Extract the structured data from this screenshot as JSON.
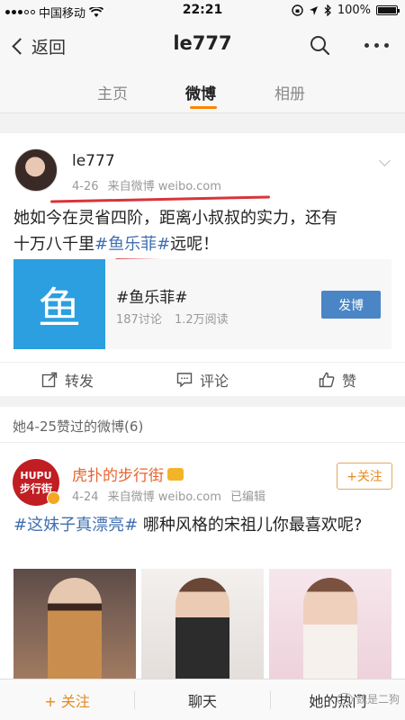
{
  "status_bar": {
    "carrier": "中国移动",
    "time": "22:21",
    "battery": "100%",
    "battery_level": 1.0
  },
  "nav": {
    "back_label": "返回",
    "title": "le777"
  },
  "tabs": [
    {
      "label": "主页",
      "active": false
    },
    {
      "label": "微博",
      "active": true
    },
    {
      "label": "相册",
      "active": false
    }
  ],
  "post": {
    "username": "le777",
    "date": "4-26",
    "source": "来自微博 weibo.com",
    "text_line1": "她如今在灵省四阶，距离小叔叔的实力，还有",
    "text_line2_pre": "十万八千里",
    "text_hashtag": "#鱼乐菲#",
    "text_line2_post": "远呢！",
    "topic": {
      "thumb_char": "鱼",
      "title": "#鱼乐菲#",
      "discussions": "187讨论",
      "reads": "1.2万阅读",
      "button_label": "发博"
    },
    "actions": {
      "repost": "转发",
      "comment": "评论",
      "like": "赞"
    }
  },
  "liked_section": {
    "header": "她4-25赞过的微博(6)"
  },
  "post2": {
    "logo_line1": "HUPU",
    "logo_line2": "步行街",
    "username": "虎扑的步行街",
    "date": "4-24",
    "source": "来自微博 weibo.com",
    "edited": "已编辑",
    "follow_label": "+关注",
    "hashtag": "#这妹子真漂亮#",
    "text": " 哪种风格的宋祖儿你最喜欢呢?"
  },
  "bottom_bar": {
    "follow": "+ 关注",
    "chat": "聊天",
    "hot": "她的热门"
  },
  "watermark": "魏是二狗",
  "colors": {
    "accent_orange": "#ff8200",
    "hashtag_blue": "#3f6fb0",
    "annotation_red": "#d8343a",
    "topic_blue": "#2b9fe0"
  }
}
